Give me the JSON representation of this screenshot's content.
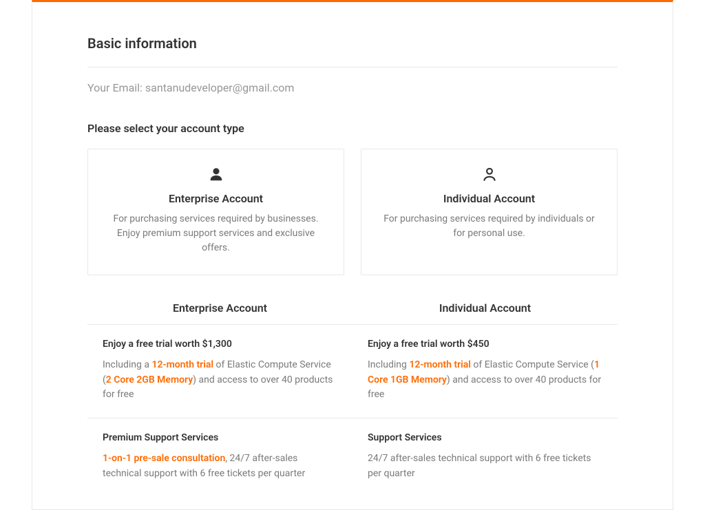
{
  "section_title": "Basic information",
  "email_label": "Your Email: ",
  "email_value": "santanudeveloper@gmail.com",
  "select_label": "Please select your account type",
  "cards": {
    "enterprise": {
      "title": "Enterprise Account",
      "desc": "For purchasing services required by businesses. Enjoy premium support services and exclusive offers."
    },
    "individual": {
      "title": "Individual Account",
      "desc": "For purchasing services required by individuals or for personal use."
    }
  },
  "compare_headers": {
    "enterprise": "Enterprise Account",
    "individual": "Individual Account"
  },
  "rows": {
    "trial": {
      "enterprise": {
        "head": "Enjoy a free trial worth $1,300",
        "p1": "Including a ",
        "hl1": "12-month trial",
        "p2": " of Elastic Compute Service (",
        "hl2": "2 Core 2GB Memory",
        "p3": ") and access to over 40 products for free"
      },
      "individual": {
        "head": "Enjoy a free trial worth $450",
        "p1": "Including ",
        "hl1": "12-month trial",
        "p2": " of Elastic Compute Service (",
        "hl2": "1 Core 1GB Memory",
        "p3": ") and access to over 40 products for free"
      }
    },
    "support": {
      "enterprise": {
        "head": "Premium Support Services",
        "hl1": "1-on-1 pre-sale consultation",
        "p1": ", 24/7 after-sales technical support with 6 free tickets per quarter"
      },
      "individual": {
        "head": "Support Services",
        "p1": "24/7 after-sales technical support with 6 free tickets per quarter"
      }
    }
  }
}
